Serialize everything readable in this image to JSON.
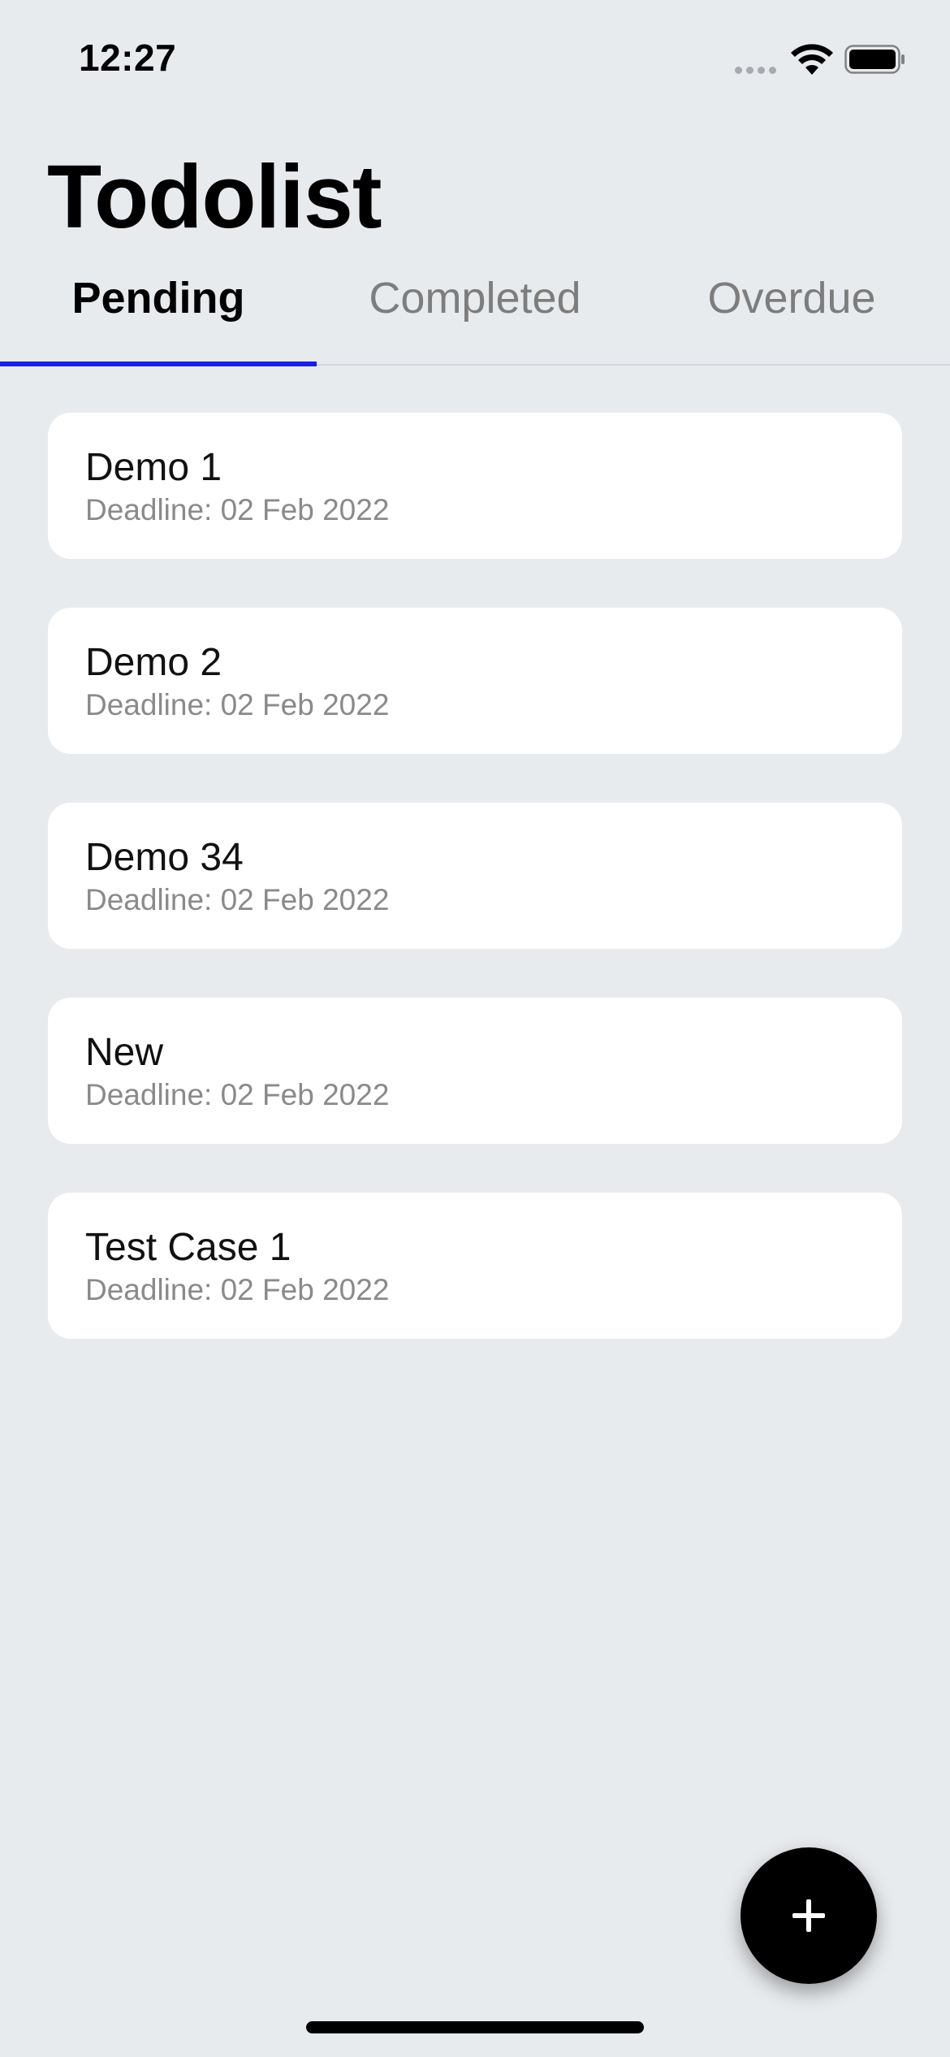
{
  "status_bar": {
    "time": "12:27",
    "signal_icon": "cellular-signal-icon",
    "wifi_icon": "wifi-icon",
    "battery_icon": "battery-icon"
  },
  "header": {
    "title": "Todolist"
  },
  "tabs": [
    {
      "label": "Pending",
      "active": true
    },
    {
      "label": "Completed",
      "active": false
    },
    {
      "label": "Overdue",
      "active": false
    }
  ],
  "tasks": [
    {
      "title": "Demo 1",
      "deadline": "Deadline: 02 Feb 2022"
    },
    {
      "title": "Demo 2",
      "deadline": "Deadline: 02 Feb 2022"
    },
    {
      "title": "Demo 34",
      "deadline": "Deadline: 02 Feb 2022"
    },
    {
      "title": "New",
      "deadline": "Deadline: 02 Feb 2022"
    },
    {
      "title": "Test Case 1",
      "deadline": "Deadline: 02 Feb 2022"
    }
  ],
  "fab": {
    "icon": "plus-icon"
  },
  "colors": {
    "background": "#e8ebee",
    "card": "#ffffff",
    "accent": "#1a1fe0",
    "fab": "#000000",
    "muted_text": "#8a8a8a"
  }
}
